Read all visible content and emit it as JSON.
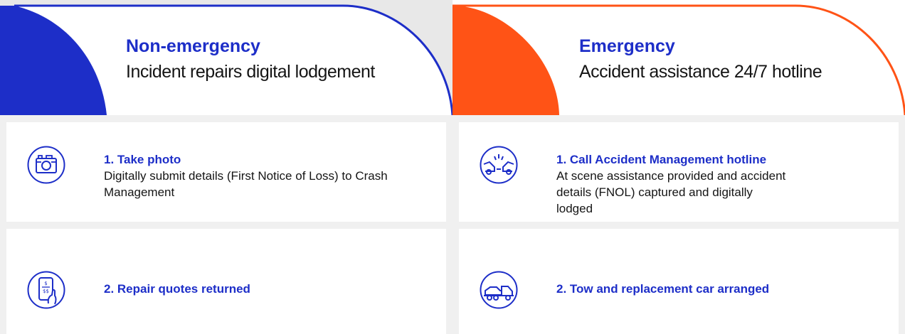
{
  "non_emergency": {
    "title": "Non-emergency",
    "subtitle": "Incident repairs digital lodgement",
    "accent_color": "#1d2ec8",
    "steps": [
      {
        "title": "1. Take photo",
        "description": "Digitally submit details (First Notice of Loss) to Crash Management",
        "icon": "camera-icon"
      },
      {
        "title": "2. Repair quotes returned",
        "description": "",
        "icon": "phone-quote-icon"
      }
    ]
  },
  "emergency": {
    "title": "Emergency",
    "subtitle": "Accident assistance 24/7 hotline",
    "accent_color": "#ff5316",
    "steps": [
      {
        "title": "1. Call Accident Management hotline",
        "description": "At scene assistance provided and accident details (FNOL) captured and digitally lodged",
        "icon": "car-crash-icon"
      },
      {
        "title": "2. Tow and replacement car arranged",
        "description": "",
        "icon": "tow-truck-icon"
      }
    ]
  }
}
